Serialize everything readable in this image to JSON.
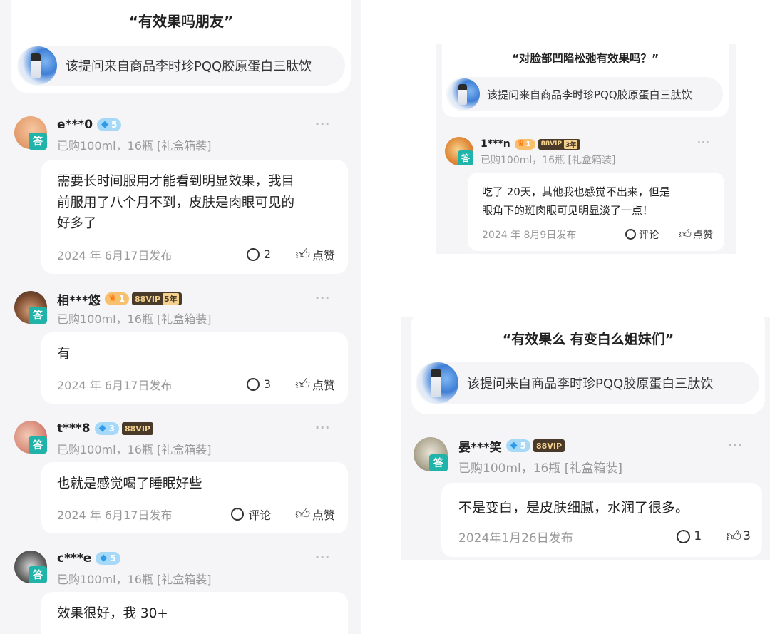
{
  "left": {
    "question": {
      "title": "“有效果吗朋友”",
      "product": "该提问来自商品李时珍PQQ胶原蛋白三肽饮"
    },
    "answers": [
      {
        "user": "e***0",
        "level": "5",
        "meta": "已购100ml，16瓶 [礼盒箱装]",
        "text_lines": [
          "需要长时间服用才能看到明显效果，我目",
          "前服用了八个月不到，皮肤是肉眼可见的",
          "好多了"
        ],
        "date": "2024 年 6月17日发布",
        "comments": "2",
        "like": "点赞"
      },
      {
        "user": "相***悠",
        "level": "1",
        "vip": "88VIP",
        "vip_years": "5年",
        "meta": "已购100ml，16瓶 [礼盒箱装]",
        "text_lines": [
          "有"
        ],
        "date": "2024 年 6月17日发布",
        "comments": "3",
        "like": "点赞"
      },
      {
        "user": "t***8",
        "level": "3",
        "vip": "88VIP",
        "meta": "已购100ml，16瓶 [礼盒箱装]",
        "text_lines": [
          "也就是感觉喝了睡眠好些"
        ],
        "date": "2024 年 6月17日发布",
        "comments": "评论",
        "like": "点赞"
      },
      {
        "user": "c***e",
        "level": "5",
        "meta": "已购100ml，16瓶 [礼盒箱装]",
        "text_lines": [
          "效果很好，我 30+"
        ]
      }
    ],
    "answer_badge": "答",
    "more": "···"
  },
  "top_right": {
    "question": {
      "title": "“对脸部凹陷松弛有效果吗？”",
      "product": "该提问来自商品李时珍PQQ胶原蛋白三肽饮"
    },
    "answer": {
      "user": "1***n",
      "level": "1",
      "vip": "88VIP",
      "vip_years": "3年",
      "meta": "已购100ml，16瓶 [礼盒箱装]",
      "text_lines": [
        "吃了 20天，其他我也感觉不出来，但是",
        "眼角下的斑肉眼可见明显淡了一点！"
      ],
      "date": "2024 年 8月9日发布",
      "comments": "评论",
      "like": "点赞"
    }
  },
  "bottom_right": {
    "question": {
      "title": "“有效果么 有变白么姐妹们”",
      "product": "该提问来自商品李时珍PQQ胶原蛋白三肽饮"
    },
    "answer": {
      "user": "晏***笑",
      "level": "5",
      "vip": "88VIP",
      "meta": "已购100ml，16瓶 [礼盒箱装]",
      "text_lines": [
        "不是变白，是皮肤细腻，水润了很多。"
      ],
      "date": "2024年1月26日发布",
      "comments": "1",
      "likes": "3"
    }
  },
  "colors": {
    "answer_badge": "#1fb3a9",
    "diamond": "#a6d9f7",
    "crown": "#f8c06d",
    "vip_bg": "#4a3a2a",
    "vip_text": "#f4d28e"
  },
  "icons": [
    "comment-icon",
    "thumbs-up-icon",
    "more-icon",
    "diamond-icon",
    "crown-icon"
  ]
}
